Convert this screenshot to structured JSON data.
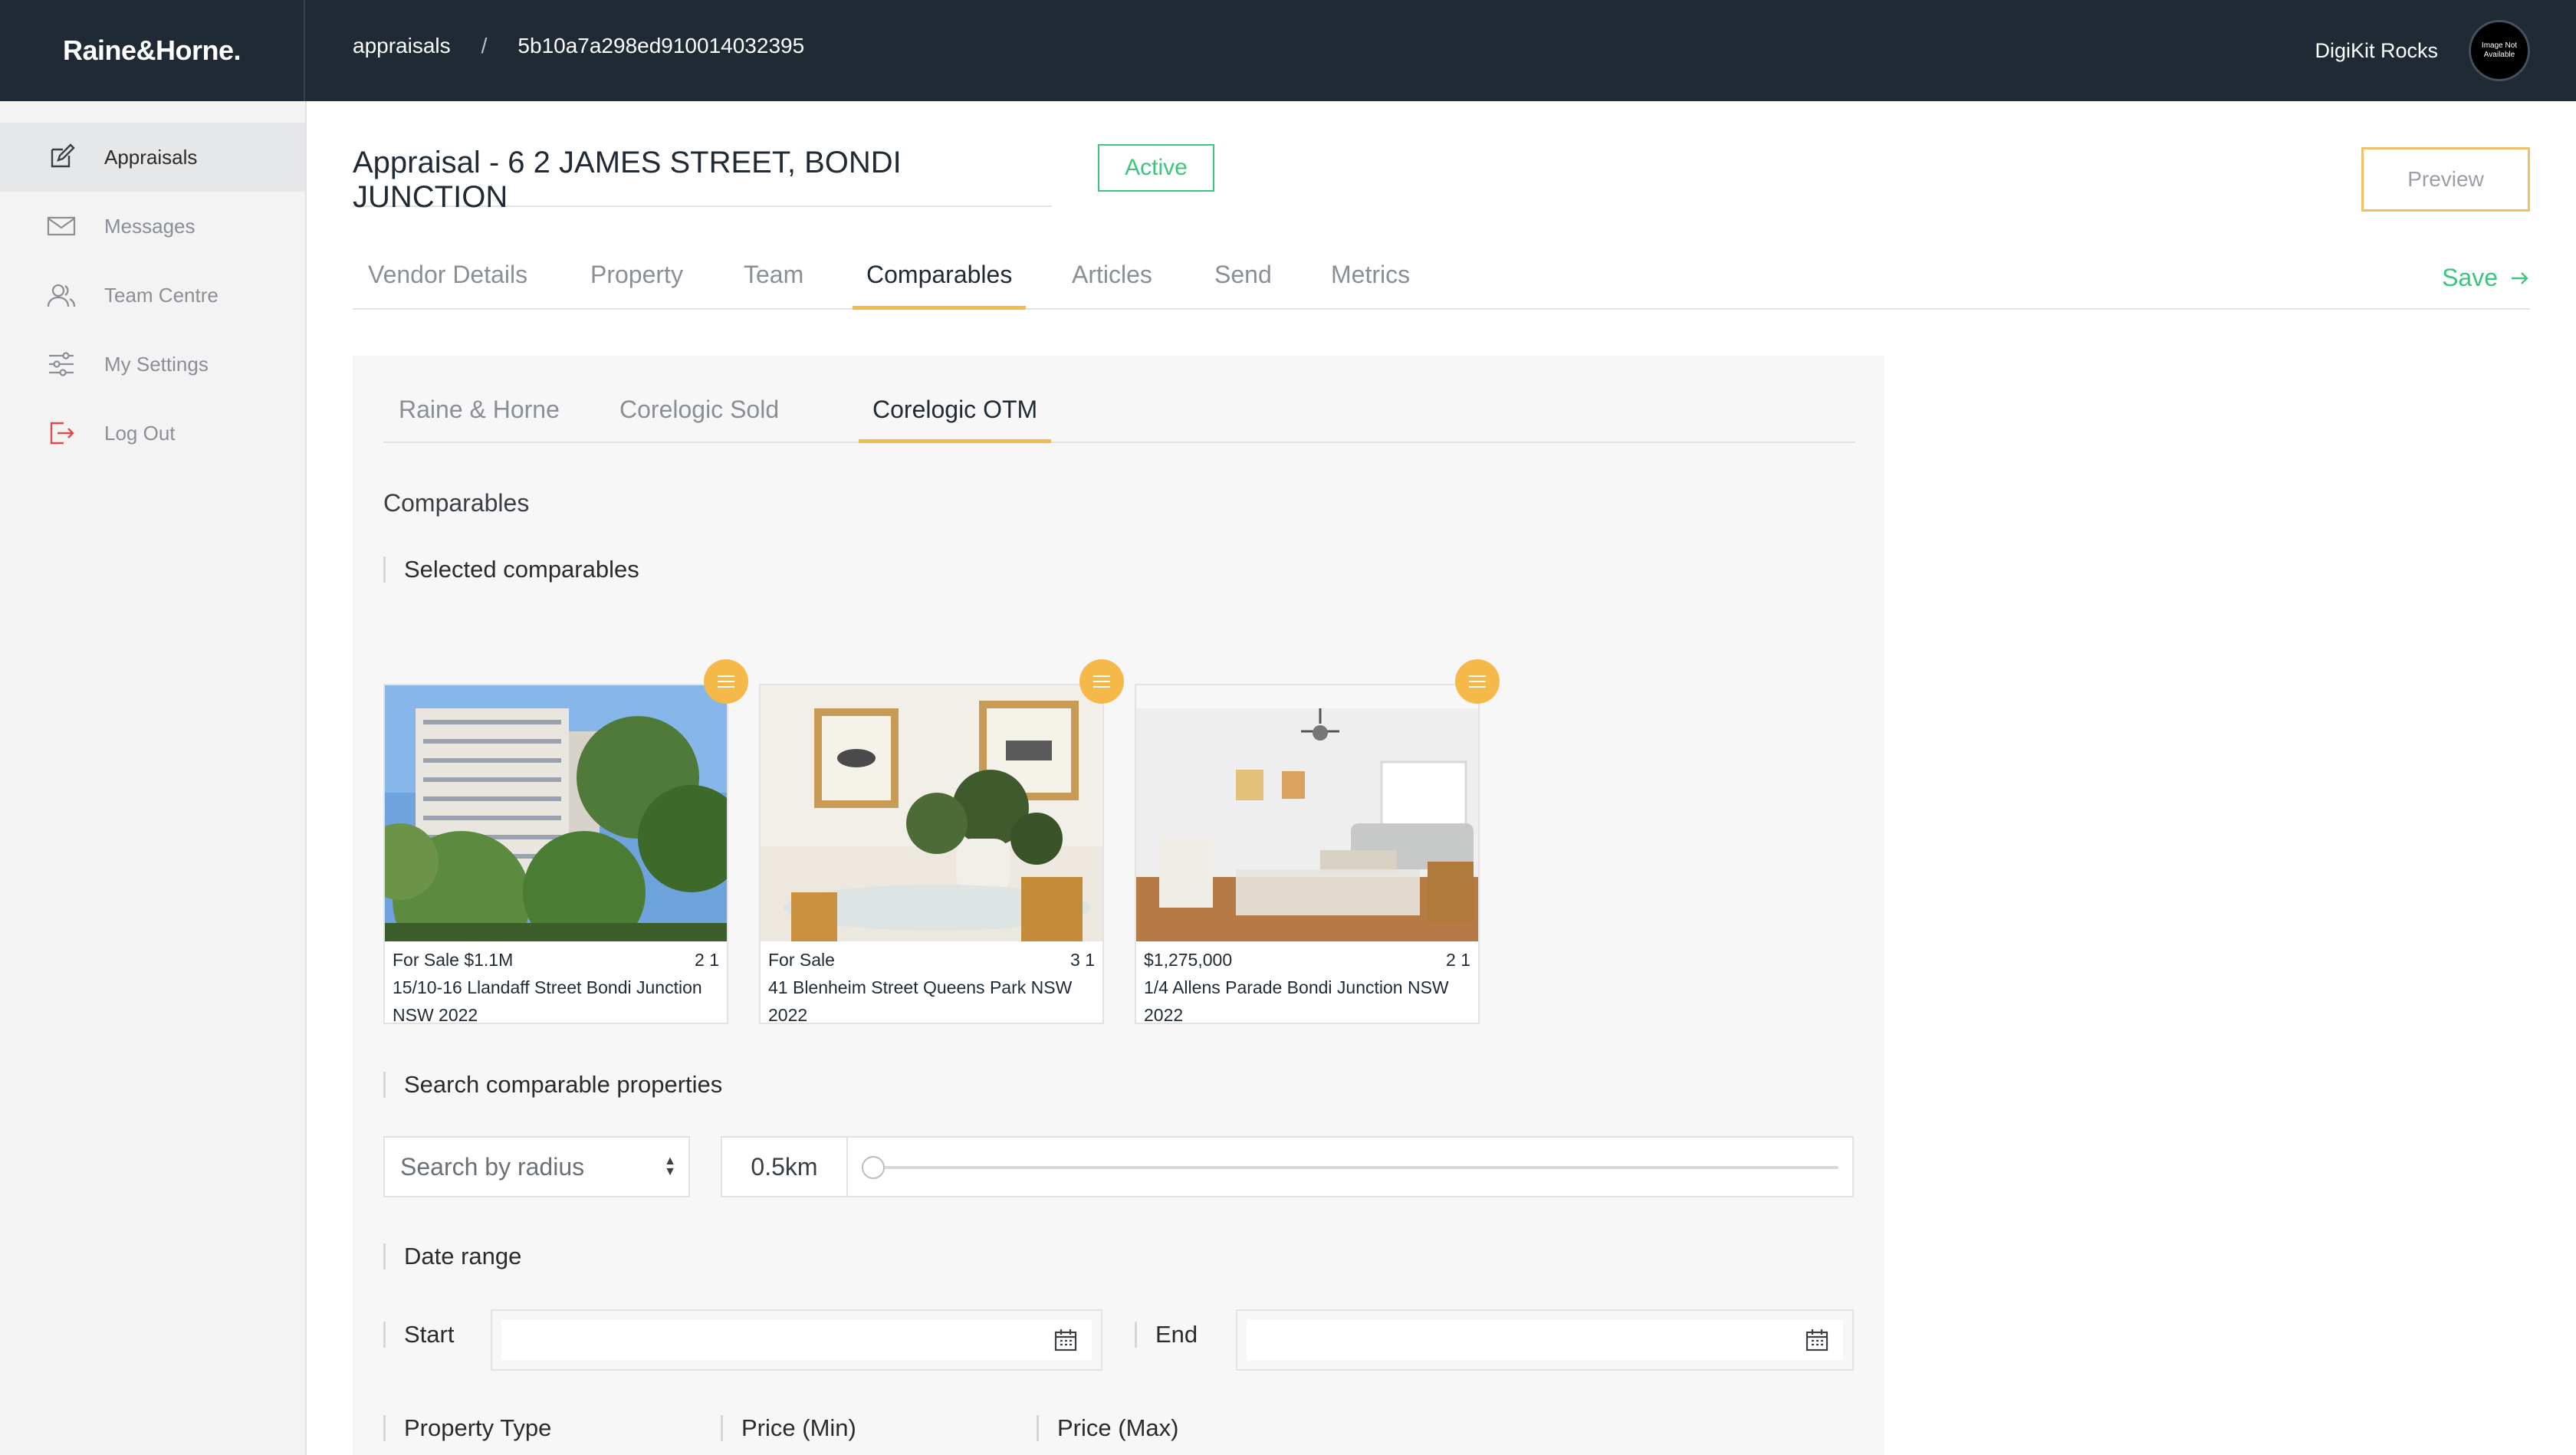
{
  "header": {
    "brand": "Raine&Horne.",
    "breadcrumb": [
      "appraisals",
      "/",
      "5b10a7a298ed910014032395"
    ],
    "user_name": "DigiKit Rocks",
    "avatar_text": "Image Not Available"
  },
  "sidebar": {
    "items": [
      {
        "label": "Appraisals",
        "icon": "edit-icon"
      },
      {
        "label": "Messages",
        "icon": "envelope-icon"
      },
      {
        "label": "Team Centre",
        "icon": "users-icon"
      },
      {
        "label": "My Settings",
        "icon": "sliders-icon"
      },
      {
        "label": "Log Out",
        "icon": "logout-icon"
      }
    ]
  },
  "page": {
    "title": "Appraisal - 6 2 JAMES STREET, BONDI JUNCTION",
    "status": "Active",
    "preview_label": "Preview",
    "save_label": "Save",
    "tabs": [
      "Vendor Details",
      "Property",
      "Team",
      "Comparables",
      "Articles",
      "Send",
      "Metrics"
    ],
    "active_tab": "Comparables"
  },
  "panel": {
    "subtabs": [
      "Raine & Horne",
      "Corelogic Sold",
      "Corelogic OTM"
    ],
    "active_subtab": "Corelogic OTM",
    "section_title": "Comparables",
    "selected_label": "Selected comparables",
    "cards": [
      {
        "price": "For Sale $1.1M",
        "beds_baths": "2 1",
        "address": "15/10-16 Llandaff Street Bondi Junction NSW 2022"
      },
      {
        "price": "For Sale",
        "beds_baths": "3 1",
        "address": "41 Blenheim Street Queens Park NSW 2022"
      },
      {
        "price": "$1,275,000",
        "beds_baths": "2 1",
        "address": "1/4 Allens Parade Bondi Junction NSW 2022"
      }
    ],
    "search_label": "Search comparable properties",
    "search_mode": "Search by radius",
    "radius_value": "0.5km",
    "date_range_label": "Date range",
    "start_label": "Start",
    "end_label": "End",
    "property_type_label": "Property Type",
    "price_min_label": "Price (Min)",
    "price_max_label": "Price (Max)"
  },
  "colors": {
    "topbar": "#1f2a35",
    "accent": "#f5b94a",
    "success": "#3cc67d"
  }
}
